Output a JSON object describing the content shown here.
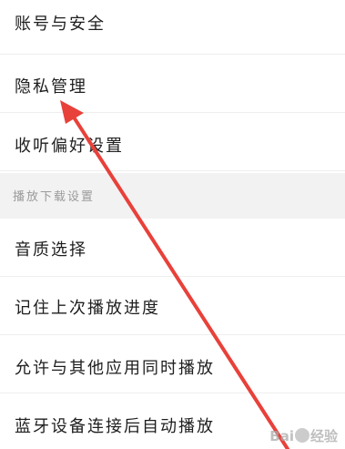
{
  "settings_items": [
    {
      "label": "账号与安全"
    },
    {
      "label": "隐私管理"
    },
    {
      "label": "收听偏好设置"
    }
  ],
  "section": {
    "label": "播放下载设置"
  },
  "playback_items": [
    {
      "label": "音质选择"
    },
    {
      "label": "记住上次播放进度"
    },
    {
      "label": "允许与其他应用同时播放"
    },
    {
      "label": "蓝牙设备连接后自动播放"
    }
  ],
  "annotation": {
    "color": "#e8413a",
    "icon": "red-arrow"
  },
  "watermark": {
    "brand_left": "Bai",
    "brand_right": "经验",
    "logo_icon": "baidu-paw-icon"
  }
}
